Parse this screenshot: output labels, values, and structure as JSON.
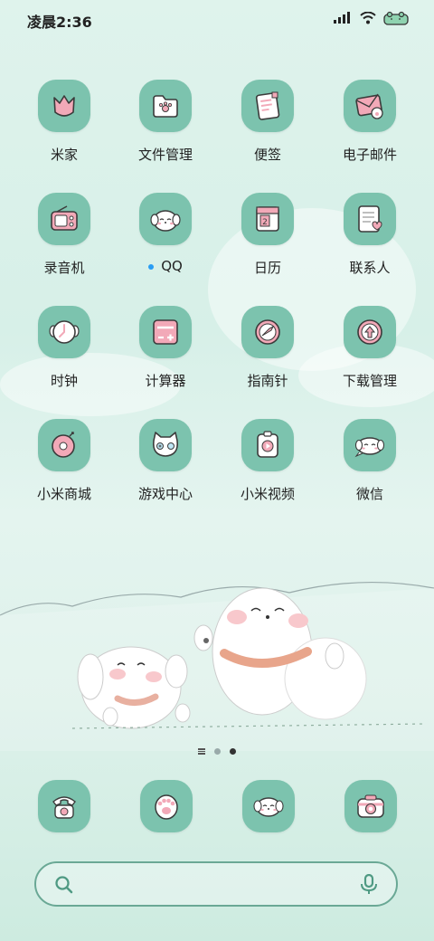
{
  "status_bar": {
    "time": "凌晨2:36",
    "icons": [
      "signal-bars-icon",
      "wifi-icon",
      "battery-icon"
    ]
  },
  "theme": {
    "tile_color": "#7cc3ae",
    "icon_pink": "#f2a9b8",
    "outline": "#3b3b3b"
  },
  "apps": [
    {
      "label": "米家",
      "icon": "mi-home-icon"
    },
    {
      "label": "文件管理",
      "icon": "file-manager-icon"
    },
    {
      "label": "便签",
      "icon": "notes-icon"
    },
    {
      "label": "电子邮件",
      "icon": "email-icon"
    },
    {
      "label": "录音机",
      "icon": "recorder-icon"
    },
    {
      "label": "QQ",
      "icon": "qq-icon",
      "has_notification_dot": true
    },
    {
      "label": "日历",
      "icon": "calendar-icon",
      "calendar_day": "2"
    },
    {
      "label": "联系人",
      "icon": "contacts-icon"
    },
    {
      "label": "时钟",
      "icon": "clock-icon"
    },
    {
      "label": "计算器",
      "icon": "calculator-icon"
    },
    {
      "label": "指南针",
      "icon": "compass-icon"
    },
    {
      "label": "下载管理",
      "icon": "download-icon"
    },
    {
      "label": "小米商城",
      "icon": "mi-store-icon"
    },
    {
      "label": "游戏中心",
      "icon": "game-center-icon"
    },
    {
      "label": "小米视频",
      "icon": "mi-video-icon"
    },
    {
      "label": "微信",
      "icon": "wechat-icon"
    }
  ],
  "page_indicator": {
    "pages": 2,
    "active_index": 1
  },
  "dock": [
    {
      "icon": "phone-icon"
    },
    {
      "icon": "paw-messages-icon"
    },
    {
      "icon": "puppy-browser-icon"
    },
    {
      "icon": "camera-icon"
    }
  ],
  "search": {
    "placeholder": ""
  }
}
